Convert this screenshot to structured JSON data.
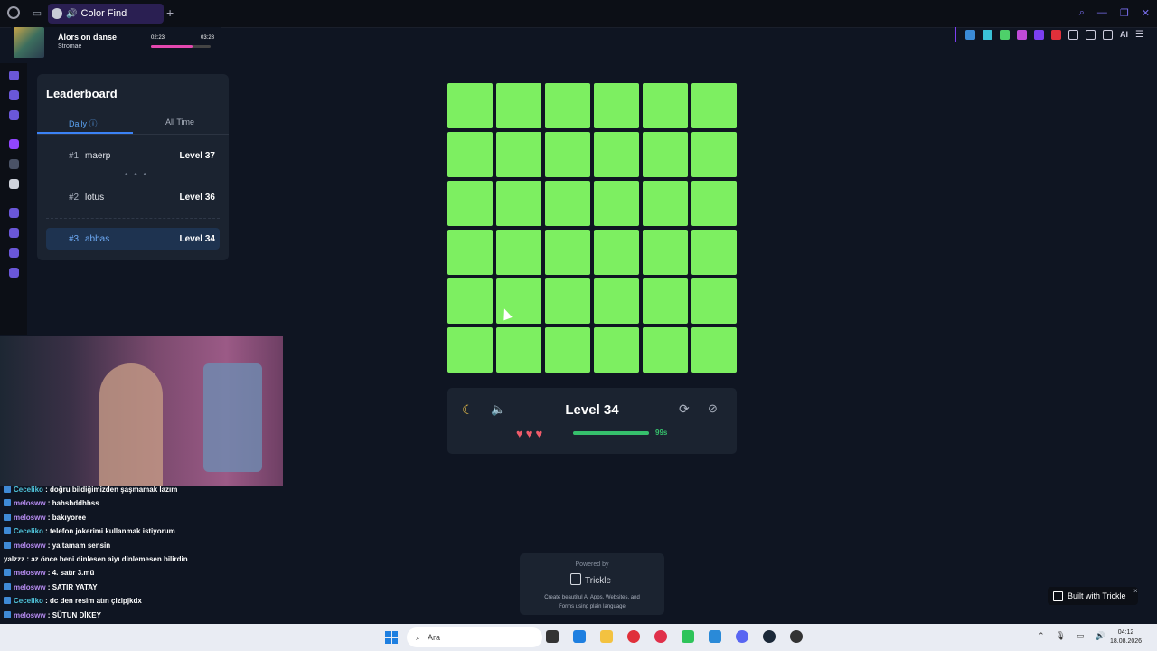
{
  "browser": {
    "tab_title": "Color Find",
    "new_tab": "+",
    "ai_label": "AI"
  },
  "player": {
    "song": "Alors on danse",
    "artist": "Stromae",
    "elapsed": "02:23",
    "total": "03:28",
    "progress": 0.7
  },
  "leaderboard": {
    "title": "Leaderboard",
    "tabs": [
      {
        "label": "Daily",
        "active": true
      },
      {
        "label": "All Time",
        "active": false
      }
    ],
    "rows": [
      {
        "rank": "#1",
        "name": "maerp",
        "level": "Level 37"
      },
      {
        "rank": "#2",
        "name": "lotus",
        "level": "Level 36"
      },
      {
        "rank": "#3",
        "name": "abbas",
        "level": "Level 34",
        "current_user": true
      }
    ],
    "separator": "• • •"
  },
  "game": {
    "grid_size": 6,
    "tile_color": "#7def61",
    "level_label": "Level 34",
    "hearts": "♥♥♥",
    "lives": 3,
    "time_label": "99s",
    "time_progress": 1.0
  },
  "chat": [
    {
      "user": "Ceceliko",
      "text": " : doğru bildiğimizden şaşmamak lazım",
      "cls": "u1"
    },
    {
      "user": "melosww",
      "text": " : hahshddhhss",
      "cls": "u2"
    },
    {
      "user": "melosww",
      "text": " : bakıyoree",
      "cls": "u2"
    },
    {
      "user": "Ceceliko",
      "text": " : telefon jokerimi kullanmak istiyorum",
      "cls": "u1"
    },
    {
      "user": "melosww",
      "text": " : ya tamam sensin",
      "cls": "u2"
    },
    {
      "user": "yalzzz",
      "text": " : az önce beni dinlesen aiyı dinlemesen bilirdin",
      "cls": "plain"
    },
    {
      "user": "melosww",
      "text": " : 4. satır 3.mü",
      "cls": "u2"
    },
    {
      "user": "melosww",
      "text": " : SATIR YATAY",
      "cls": "u2"
    },
    {
      "user": "Ceceliko",
      "text": " : dc den resim atın çizipjkdx",
      "cls": "u1"
    },
    {
      "user": "melosww",
      "text": " : SÜTUN DİKEY",
      "cls": "u2"
    }
  ],
  "trickle": {
    "powered": "Powered by",
    "brand": "Trickle",
    "desc": "Create beautiful AI Apps, Websites, and Forms using plain language"
  },
  "built_with": "Built with Trickle",
  "taskbar": {
    "search_placeholder": "Ara",
    "time": "04:12",
    "date": "18.08.2026"
  },
  "colors": {
    "accent": "#3b82f6",
    "tile": "#7def61",
    "heart": "#ef5b6a",
    "timer": "#36c06c"
  }
}
